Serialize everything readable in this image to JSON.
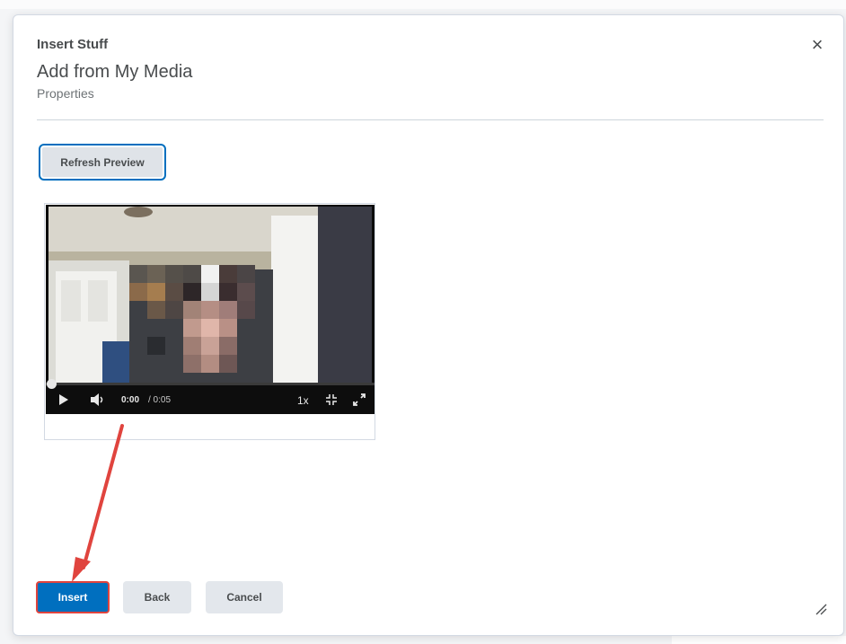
{
  "dialog": {
    "overline": "Insert Stuff",
    "title": "Add from My Media",
    "subtitle": "Properties",
    "close_icon": "close-icon"
  },
  "preview": {
    "refresh_label": "Refresh Preview"
  },
  "player": {
    "current_time": "0:00",
    "duration": "/ 0:05",
    "speed": "1x",
    "progress": 0,
    "icons": [
      "play-icon",
      "volume-icon",
      "collapse-icon",
      "fullscreen-icon"
    ]
  },
  "footer": {
    "insert_label": "Insert",
    "back_label": "Back",
    "cancel_label": "Cancel"
  },
  "colors": {
    "primary": "#006fbf",
    "annotation": "#e0443e",
    "text": "#494c4e"
  }
}
